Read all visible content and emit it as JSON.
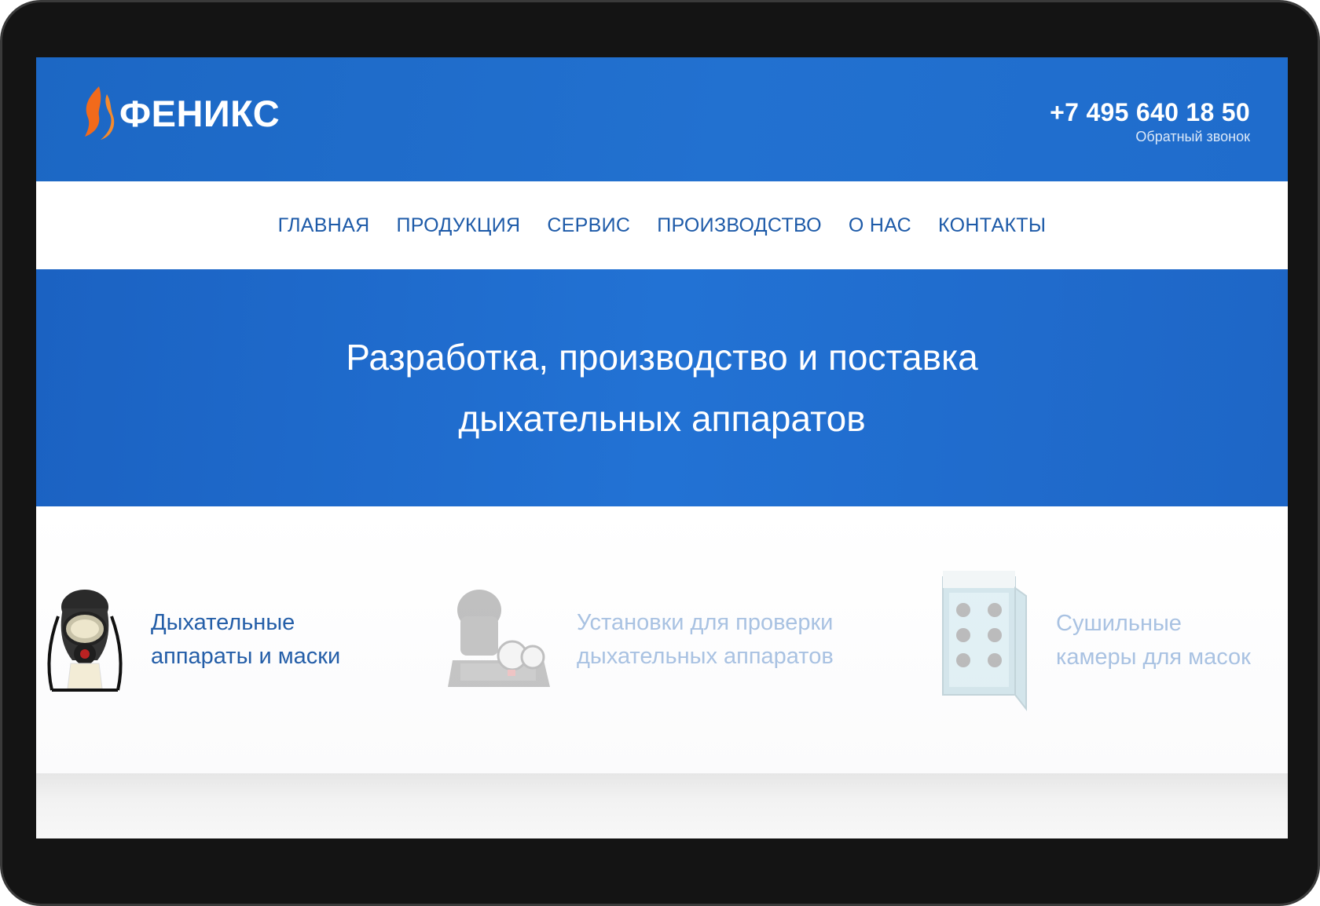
{
  "header": {
    "logo_text": "ФЕНИКС",
    "phone": "+7 495 640 18 50",
    "callback": "Обратный звонок"
  },
  "nav": {
    "items": [
      "ГЛАВНАЯ",
      "ПРОДУКЦИЯ",
      "СЕРВИС",
      "ПРОИЗВОДСТВО",
      "О НАС",
      "КОНТАКТЫ"
    ]
  },
  "hero": {
    "line1": "Разработка, производство и поставка",
    "line2": "дыхательных аппаратов"
  },
  "categories": [
    {
      "line1": "Дыхательные",
      "line2": "аппараты и маски",
      "icon": "gas-mask-icon"
    },
    {
      "line1": "Установки для проверки",
      "line2": "дыхательных аппаратов",
      "icon": "test-device-icon"
    },
    {
      "line1": "Сушильные",
      "line2": "камеры для масок",
      "icon": "drying-cabinet-icon"
    }
  ],
  "colors": {
    "brand_blue": "#1f6ccc",
    "nav_text": "#1d5aa8",
    "flame_orange": "#f26a1b"
  }
}
